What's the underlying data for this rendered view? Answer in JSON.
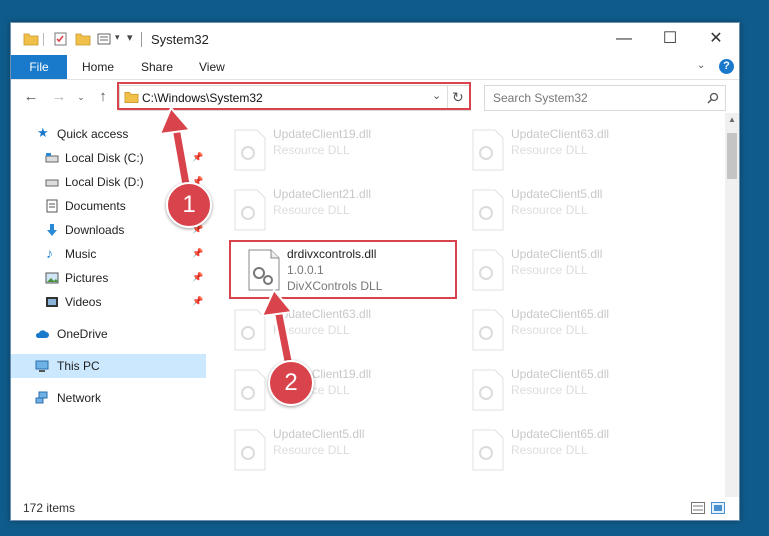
{
  "window": {
    "title": "System32"
  },
  "ribbon": {
    "tabs": [
      {
        "label": "File"
      },
      {
        "label": "Home"
      },
      {
        "label": "Share"
      },
      {
        "label": "View"
      }
    ]
  },
  "address": {
    "path": "C:\\Windows\\System32"
  },
  "search": {
    "placeholder": "Search System32"
  },
  "sidebar": {
    "items": [
      {
        "label": "Quick access",
        "icon": "star-icon"
      },
      {
        "label": "Local Disk (C:)",
        "icon": "drive-icon",
        "pinned": true
      },
      {
        "label": "Local Disk (D:)",
        "icon": "drive-icon",
        "pinned": true
      },
      {
        "label": "Documents",
        "icon": "documents-icon",
        "pinned": true
      },
      {
        "label": "Downloads",
        "icon": "download-icon",
        "pinned": true
      },
      {
        "label": "Music",
        "icon": "music-icon",
        "pinned": true
      },
      {
        "label": "Pictures",
        "icon": "pictures-icon",
        "pinned": true
      },
      {
        "label": "Videos",
        "icon": "videos-icon",
        "pinned": true
      },
      {
        "label": "OneDrive",
        "icon": "cloud-icon"
      },
      {
        "label": "This PC",
        "icon": "computer-icon",
        "selected": true
      },
      {
        "label": "Network",
        "icon": "network-icon"
      }
    ]
  },
  "files": [
    {
      "name": "UpdateClient19.dll",
      "line2": "Resource DLL",
      "line3": ""
    },
    {
      "name": "UpdateClient63.dll",
      "line2": "Resource DLL",
      "line3": ""
    },
    {
      "name": "UpdateClient21.dll",
      "line2": "Resource DLL",
      "line3": ""
    },
    {
      "name": "UpdateClient5.dll",
      "line2": "Resource DLL",
      "line3": ""
    },
    {
      "name": "drdivxcontrols.dll",
      "line2": "1.0.0.1",
      "line3": "DivXControls DLL"
    },
    {
      "name": "UpdateClient5.dll",
      "line2": "Resource DLL",
      "line3": ""
    },
    {
      "name": "UpdateClient63.dll",
      "line2": "Resource DLL",
      "line3": ""
    },
    {
      "name": "UpdateClient65.dll",
      "line2": "Resource DLL",
      "line3": ""
    },
    {
      "name": "UpdateClient19.dll",
      "line2": "Resource DLL",
      "line3": ""
    },
    {
      "name": "UpdateClient65.dll",
      "line2": "Resource DLL",
      "line3": ""
    },
    {
      "name": "UpdateClient5.dll",
      "line2": "Resource DLL",
      "line3": ""
    },
    {
      "name": "UpdateClient65.dll",
      "line2": "Resource DLL",
      "line3": ""
    }
  ],
  "status": {
    "item_count": "172 items"
  },
  "annotations": {
    "step1": "1",
    "step2": "2",
    "color": "#d9434b"
  },
  "colors": {
    "file_tab": "#1979ca",
    "selected_nav": "#cce8ff",
    "desktop": "#0f5c8c"
  }
}
